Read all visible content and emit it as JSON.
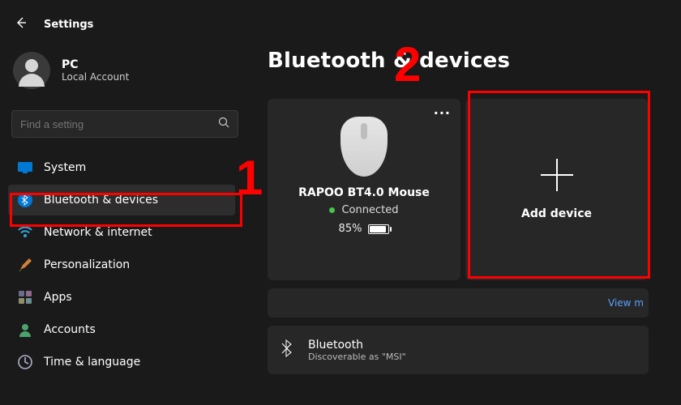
{
  "header": {
    "title": "Settings"
  },
  "user": {
    "name": "PC",
    "subtitle": "Local Account"
  },
  "search": {
    "placeholder": "Find a setting"
  },
  "nav": {
    "system": "System",
    "bluetooth": "Bluetooth & devices",
    "network": "Network & internet",
    "personalization": "Personalization",
    "apps": "Apps",
    "accounts": "Accounts",
    "time": "Time & language"
  },
  "main_title": "Bluetooth & devices",
  "device": {
    "name": "RAPOO BT4.0 Mouse",
    "status": "Connected",
    "battery": "85%"
  },
  "add_device_label": "Add device",
  "view_more_label": "View m",
  "bluetooth_card": {
    "title": "Bluetooth",
    "subtitle": "Discoverable as \"MSI\""
  },
  "annotations": {
    "one": "1",
    "two": "2"
  }
}
